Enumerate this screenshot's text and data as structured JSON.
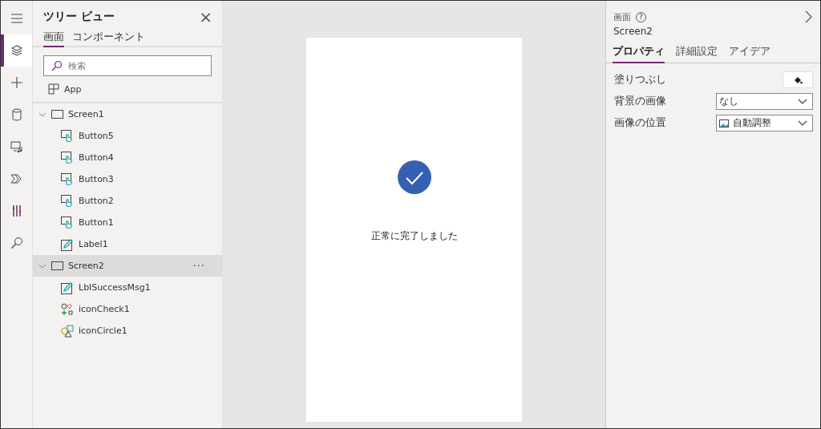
{
  "rail": [
    {
      "kind": "menu",
      "selected": false
    },
    {
      "kind": "layers",
      "selected": true
    },
    {
      "kind": "plus",
      "selected": false
    },
    {
      "kind": "database",
      "selected": false
    },
    {
      "kind": "media",
      "selected": false
    },
    {
      "kind": "flow",
      "selected": false
    },
    {
      "kind": "tools",
      "selected": false
    },
    {
      "kind": "search",
      "selected": false
    }
  ],
  "tree_panel": {
    "title": "ツリー ビュー",
    "close": "×",
    "tabs": [
      {
        "label": "画面",
        "selected": true
      },
      {
        "label": "コンポーネント",
        "selected": false
      }
    ],
    "search": {
      "placeholder": "検索"
    },
    "app_item": {
      "label": "App"
    },
    "screens": [
      {
        "label": "Screen1",
        "expanded": true,
        "selected": false,
        "children": [
          {
            "label": "Button5",
            "kind": "button"
          },
          {
            "label": "Button4",
            "kind": "button"
          },
          {
            "label": "Button3",
            "kind": "button"
          },
          {
            "label": "Button2",
            "kind": "button"
          },
          {
            "label": "Button1",
            "kind": "button"
          },
          {
            "label": "Label1",
            "kind": "label"
          }
        ]
      },
      {
        "label": "Screen2",
        "expanded": true,
        "selected": true,
        "more": "···",
        "children": [
          {
            "label": "LblSuccessMsg1",
            "kind": "label"
          },
          {
            "label": "iconCheck1",
            "kind": "icons"
          },
          {
            "label": "iconCircle1",
            "kind": "media"
          }
        ]
      }
    ]
  },
  "canvas": {
    "message": "正常に完了しました"
  },
  "properties": {
    "type_label": "画面",
    "help": "?",
    "name": "Screen2",
    "tabs": [
      {
        "label": "プロパティ",
        "selected": true
      },
      {
        "label": "詳細設定",
        "selected": false
      },
      {
        "label": "アイデア",
        "selected": false
      }
    ],
    "rows": [
      {
        "label": "塗りつぶし",
        "kind": "color"
      },
      {
        "label": "背景の画像",
        "kind": "dropdown",
        "value": "なし"
      },
      {
        "label": "画像の位置",
        "kind": "dropdown",
        "value": "自動調整",
        "icon": true
      }
    ]
  }
}
